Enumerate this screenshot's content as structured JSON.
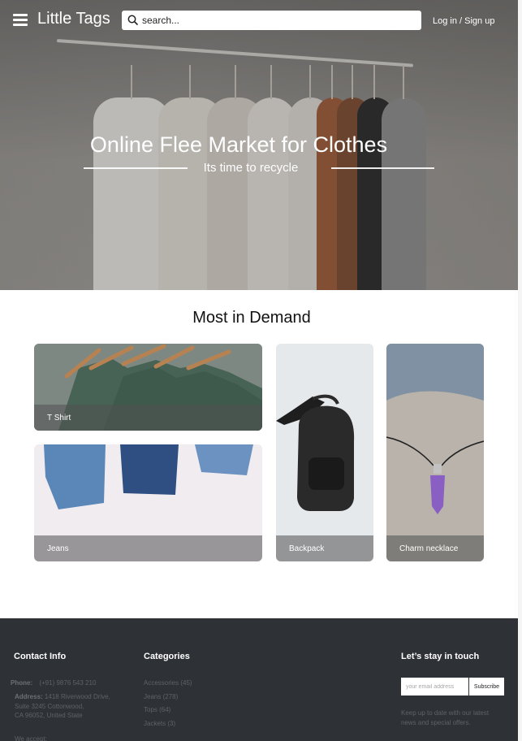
{
  "header": {
    "brand": "Little Tags",
    "search_placeholder": "search...",
    "login_label": "Log in / Sign up"
  },
  "hero": {
    "title": "Online Flee Market for Clothes",
    "subtitle": "Its time to recycle"
  },
  "demand": {
    "title": "Most in Demand",
    "items": [
      {
        "label": "T Shirt"
      },
      {
        "label": "Jeans"
      },
      {
        "label": "Backpack"
      },
      {
        "label": "Charm necklace"
      }
    ]
  },
  "footer": {
    "contact": {
      "heading": "Contact Info",
      "phone_label": "Phone:",
      "phone": "(+91) 9876 543 210",
      "address_label": "Address:",
      "address_line1": "1418 Riverwood Drive,",
      "address_line2": "Suite 3245 Cottonwood,",
      "address_line3": "CA 96052, United State",
      "we_accept": "We accept:"
    },
    "categories": {
      "heading": "Categories",
      "items": [
        "Accessories (45)",
        "Jeans (278)",
        "Tops (64)",
        "Jackets (3)"
      ]
    },
    "newsletter": {
      "heading": "Let’s stay in touch",
      "email_placeholder": "your email address",
      "subscribe_label": "Subscribe",
      "note_line1": "Keep up to date with our latest",
      "note_line2": "news and special offers."
    }
  },
  "colors": {
    "footer_bg": "#2e3135",
    "footer_text": "#5e6368",
    "white": "#ffffff"
  }
}
